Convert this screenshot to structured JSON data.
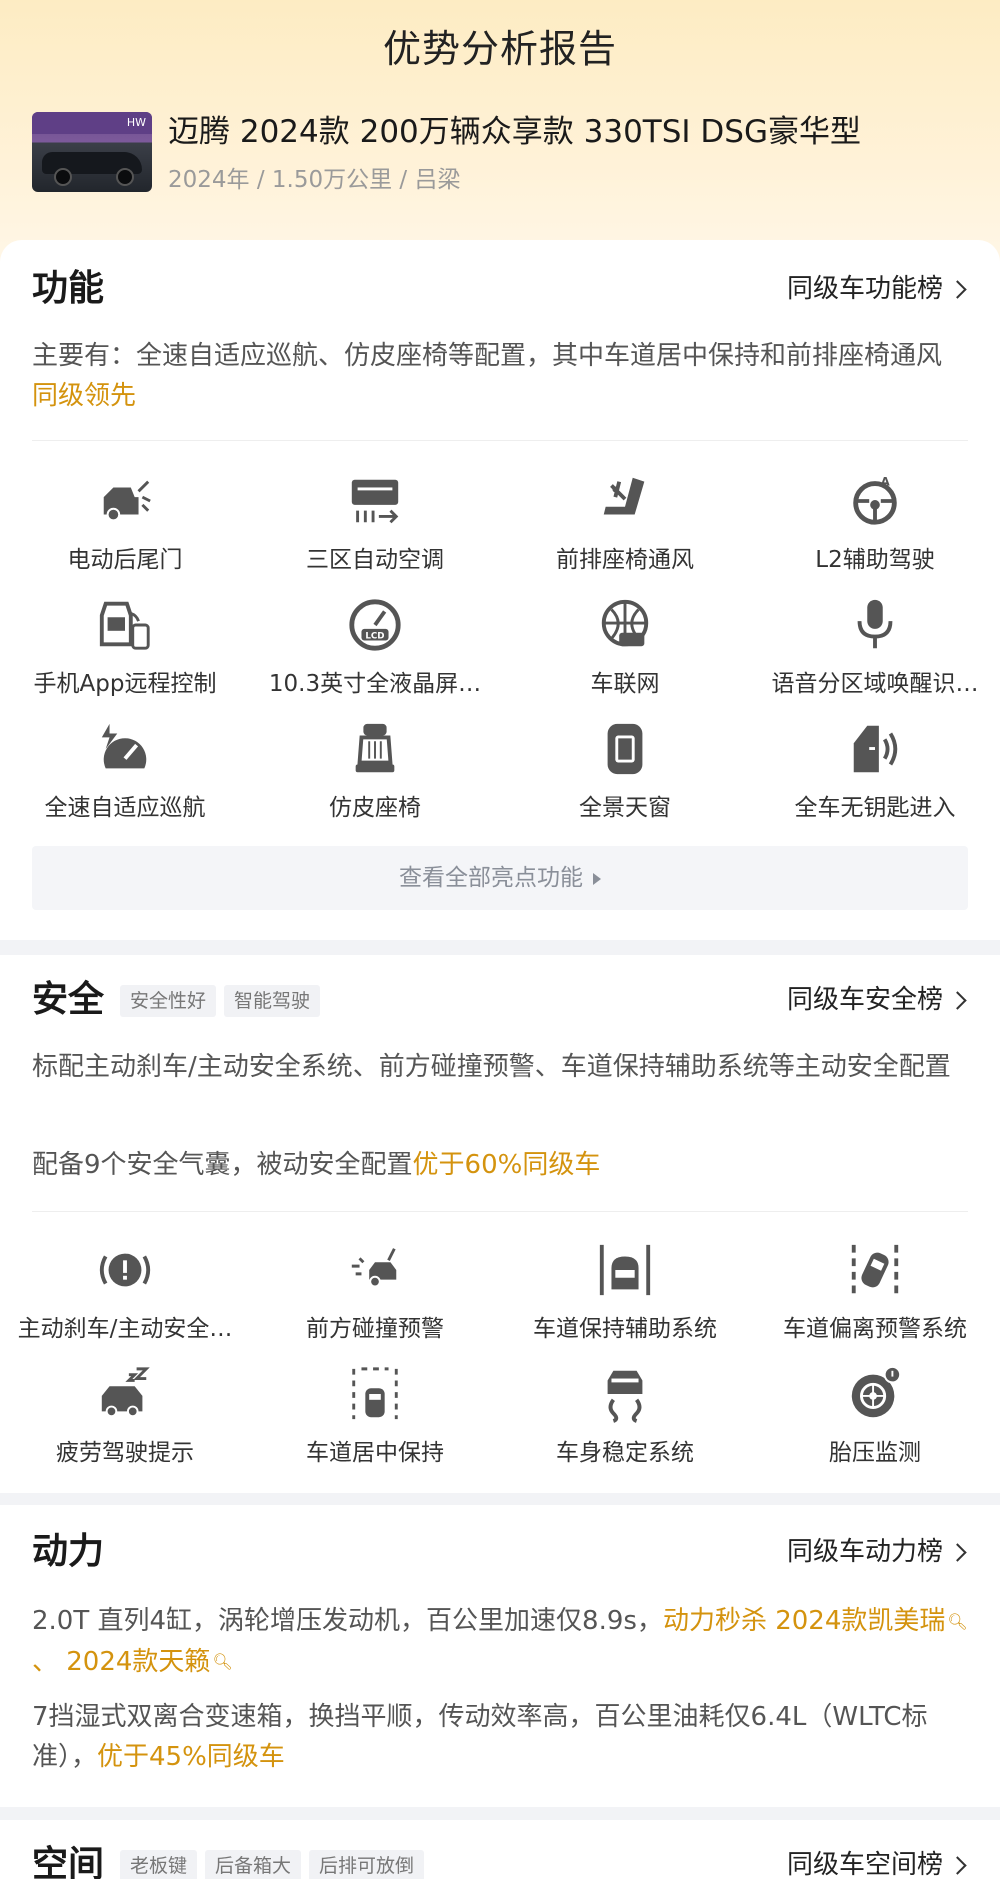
{
  "header": {
    "title": "优势分析报告",
    "car_name": "迈腾 2024款 200万辆众享款 330TSI DSG豪华型",
    "car_meta": "2024年 / 1.50万公里 / 吕梁",
    "thumb_banner": "HW"
  },
  "function": {
    "title": "功能",
    "rank_link": "同级车功能榜",
    "desc_prefix": "主要有：全速自适应巡航、仿皮座椅等配置，其中车道居中保持和前排座椅通风",
    "desc_highlight": "同级领先",
    "features": [
      {
        "label": "电动后尾门",
        "icon": "power-tailgate-icon"
      },
      {
        "label": "三区自动空调",
        "icon": "climate-control-icon"
      },
      {
        "label": "前排座椅通风",
        "icon": "seat-ventilation-icon"
      },
      {
        "label": "L2辅助驾驶",
        "icon": "steering-wheel-icon"
      },
      {
        "label": "手机App远程控制",
        "icon": "remote-phone-icon"
      },
      {
        "label": "10.3英寸全液晶屏…",
        "icon": "lcd-gauge-icon"
      },
      {
        "label": "车联网",
        "icon": "connected-car-icon"
      },
      {
        "label": "语音分区域唤醒识…",
        "icon": "microphone-icon"
      },
      {
        "label": "全速自适应巡航",
        "icon": "cruise-control-icon"
      },
      {
        "label": "仿皮座椅",
        "icon": "leather-seat-icon"
      },
      {
        "label": "全景天窗",
        "icon": "panoramic-sunroof-icon"
      },
      {
        "label": "全车无钥匙进入",
        "icon": "keyless-entry-icon"
      }
    ],
    "view_all": "查看全部亮点功能"
  },
  "safety": {
    "title": "安全",
    "tags": [
      "安全性好",
      "智能驾驶"
    ],
    "rank_link": "同级车安全榜",
    "desc1": "标配主动刹车/主动安全系统、前方碰撞预警、车道保持辅助系统等主动安全配置",
    "desc2_prefix": "配备9个安全气囊，被动安全配置",
    "desc2_highlight": "优于60%同级车",
    "features": [
      {
        "label": "主动刹车/主动安全…",
        "icon": "brake-warning-icon"
      },
      {
        "label": "前方碰撞预警",
        "icon": "collision-warning-icon"
      },
      {
        "label": "车道保持辅助系统",
        "icon": "lane-keep-icon"
      },
      {
        "label": "车道偏离预警系统",
        "icon": "lane-departure-icon"
      },
      {
        "label": "疲劳驾驶提示",
        "icon": "fatigue-alert-icon"
      },
      {
        "label": "车道居中保持",
        "icon": "lane-center-icon"
      },
      {
        "label": "车身稳定系统",
        "icon": "stability-control-icon"
      },
      {
        "label": "胎压监测",
        "icon": "tire-pressure-icon"
      }
    ]
  },
  "power": {
    "title": "动力",
    "rank_link": "同级车动力榜",
    "desc1_prefix": "2.0T 直列4缸，涡轮增压发动机，百公里加速仅8.9s，",
    "desc1_highlight": "动力秒杀 2024款凯美瑞",
    "desc1_sep": " 、 ",
    "desc1_highlight2": "2024款天籁",
    "desc2_prefix": "7挡湿式双离合变速箱，换挡平顺，传动效率高，百公里油耗仅6.4L（WLTC标准），",
    "desc2_highlight": "优于45%同级车"
  },
  "space": {
    "title": "空间",
    "tags": [
      "老板键",
      "后备箱大",
      "后排可放倒"
    ],
    "rank_link": "同级车空间榜"
  },
  "colors": {
    "accent": "#d4930e",
    "hero_top": "#fdecc3",
    "icon_gray": "#555555",
    "page_bg": "#f2f3f6"
  }
}
